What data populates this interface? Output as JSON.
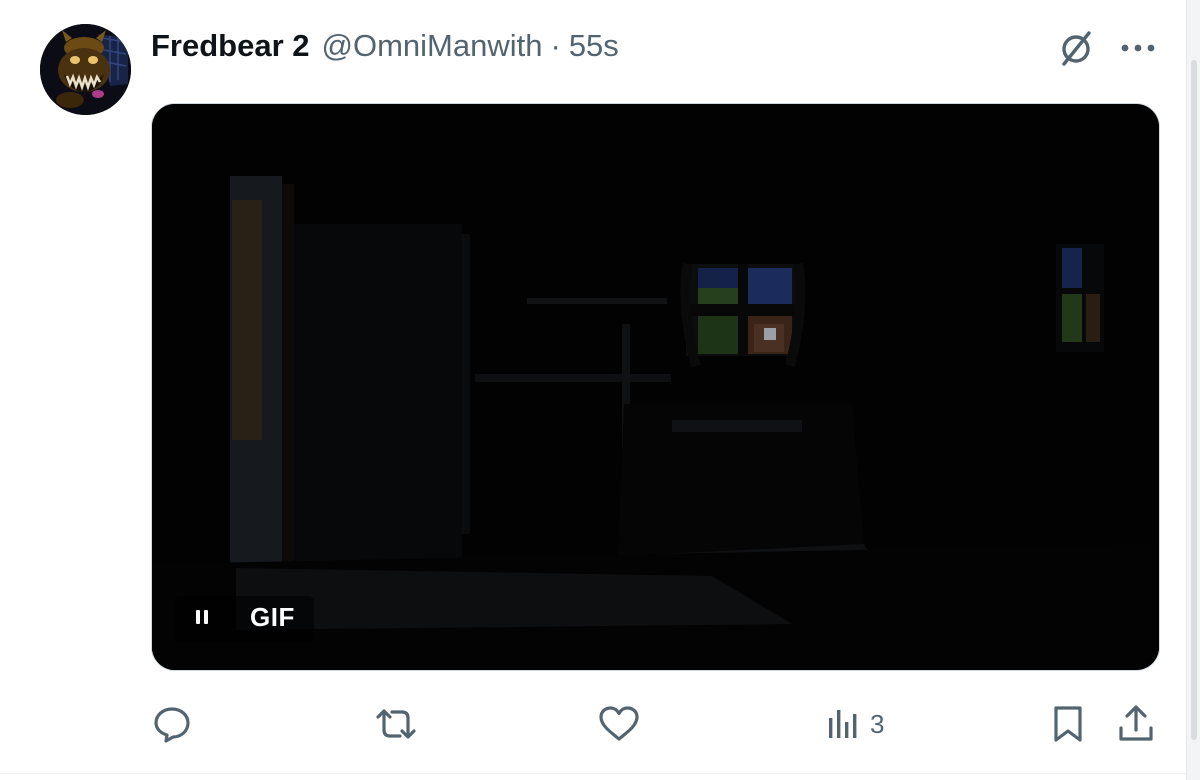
{
  "tweet": {
    "author": {
      "display_name": "Fredbear 2",
      "handle": "@OmniManwith",
      "separator": "·",
      "timestamp": "55s"
    },
    "header_icons": {
      "grok": "grok-slash-circle-icon",
      "more": "more-horizontal-icon"
    },
    "media": {
      "type": "GIF",
      "badge_label": "GIF",
      "state": "playing",
      "pause_icon": "pause-icon",
      "scene": "dark room with window at night"
    },
    "actions": {
      "reply": {
        "icon": "reply-bubble-icon",
        "count": ""
      },
      "repost": {
        "icon": "repost-arrows-icon",
        "count": ""
      },
      "like": {
        "icon": "heart-icon",
        "count": ""
      },
      "views": {
        "icon": "views-bars-icon",
        "count": "3"
      },
      "bookmark": {
        "icon": "bookmark-icon"
      },
      "share": {
        "icon": "share-upload-icon"
      }
    }
  },
  "colors": {
    "text_primary": "#0f1419",
    "text_secondary": "#536471",
    "media_bg": "#020203",
    "gif_text": "#ffffff"
  }
}
